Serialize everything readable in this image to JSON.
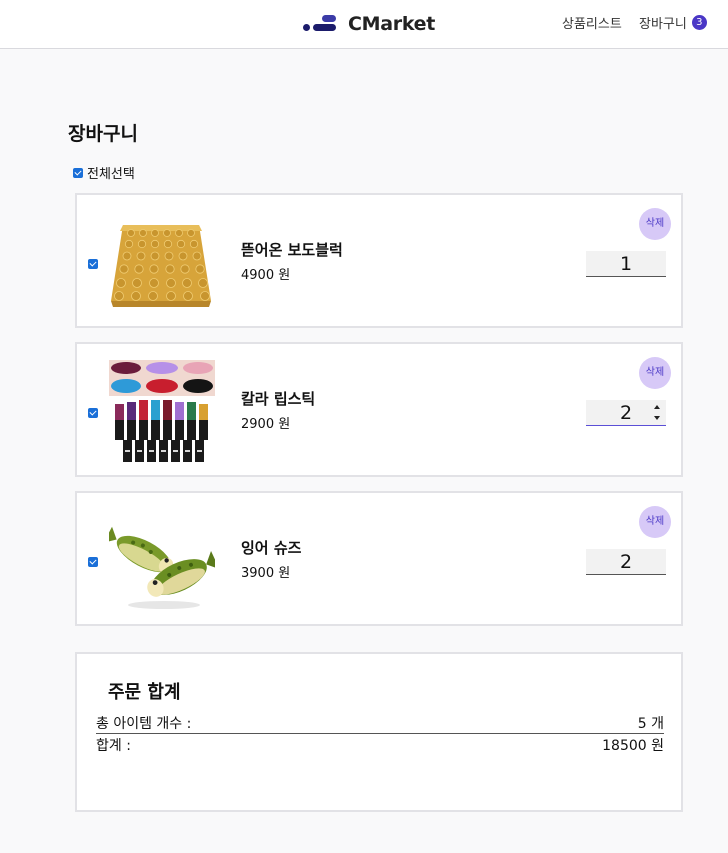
{
  "header": {
    "brand": "CMarket",
    "nav_products": "상품리스트",
    "nav_cart": "장바구니",
    "cart_count": "3"
  },
  "page": {
    "title": "장바구니",
    "select_all_label": "전체선택"
  },
  "items": [
    {
      "name": "뜯어온 보도블럭",
      "price": "4900 원",
      "quantity": "1",
      "delete_label": "삭제",
      "checked": true,
      "image": "tactile-paving-block"
    },
    {
      "name": "칼라 립스틱",
      "price": "2900 원",
      "quantity": "2",
      "delete_label": "삭제",
      "checked": true,
      "image": "color-lipsticks"
    },
    {
      "name": "잉어 슈즈",
      "price": "3900 원",
      "quantity": "2",
      "delete_label": "삭제",
      "checked": true,
      "image": "fish-slippers"
    }
  ],
  "summary": {
    "title": "주문 합계",
    "count_label": "총 아이템 개수 :",
    "count_value": "5 개",
    "total_label": "합계 :",
    "total_value": "18500 원"
  },
  "colors": {
    "accent": "#4a37c6",
    "delete_bg": "#d7c9f7",
    "checkbox": "#1a6fd8"
  }
}
